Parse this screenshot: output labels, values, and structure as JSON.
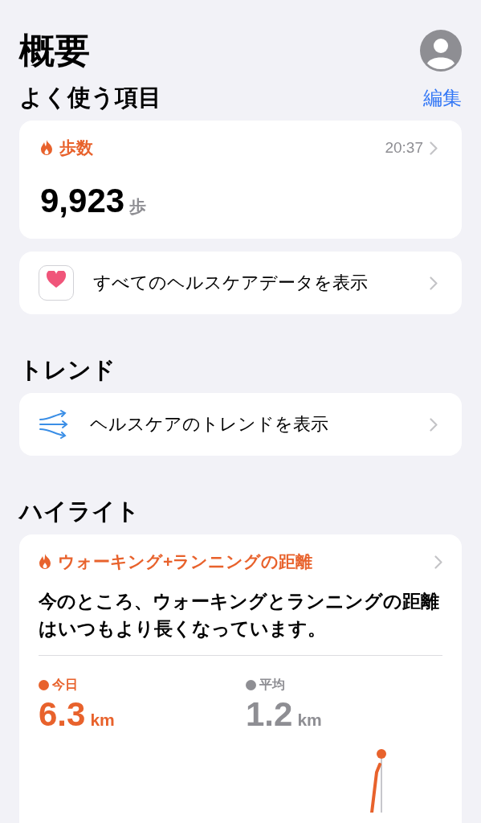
{
  "header": {
    "title": "概要"
  },
  "favorites": {
    "title": "よく使う項目",
    "edit": "編集",
    "steps_card": {
      "label": "歩数",
      "time": "20:37",
      "value": "9,923",
      "unit": "歩"
    },
    "all_data_row": {
      "label": "すべてのヘルスケアデータを表示"
    }
  },
  "trends": {
    "title": "トレンド",
    "row": {
      "label": "ヘルスケアのトレンドを表示"
    }
  },
  "highlights": {
    "title": "ハイライト",
    "card": {
      "label": "ウォーキング+ランニングの距離",
      "summary": "今のところ、ウォーキングとランニングの距離はいつもより長くなっています。",
      "stats": [
        {
          "label": "今日",
          "value": "6.3",
          "unit": "km",
          "color": "#e8622c"
        },
        {
          "label": "平均",
          "value": "1.2",
          "unit": "km",
          "color": "#8e8e93"
        }
      ]
    }
  }
}
